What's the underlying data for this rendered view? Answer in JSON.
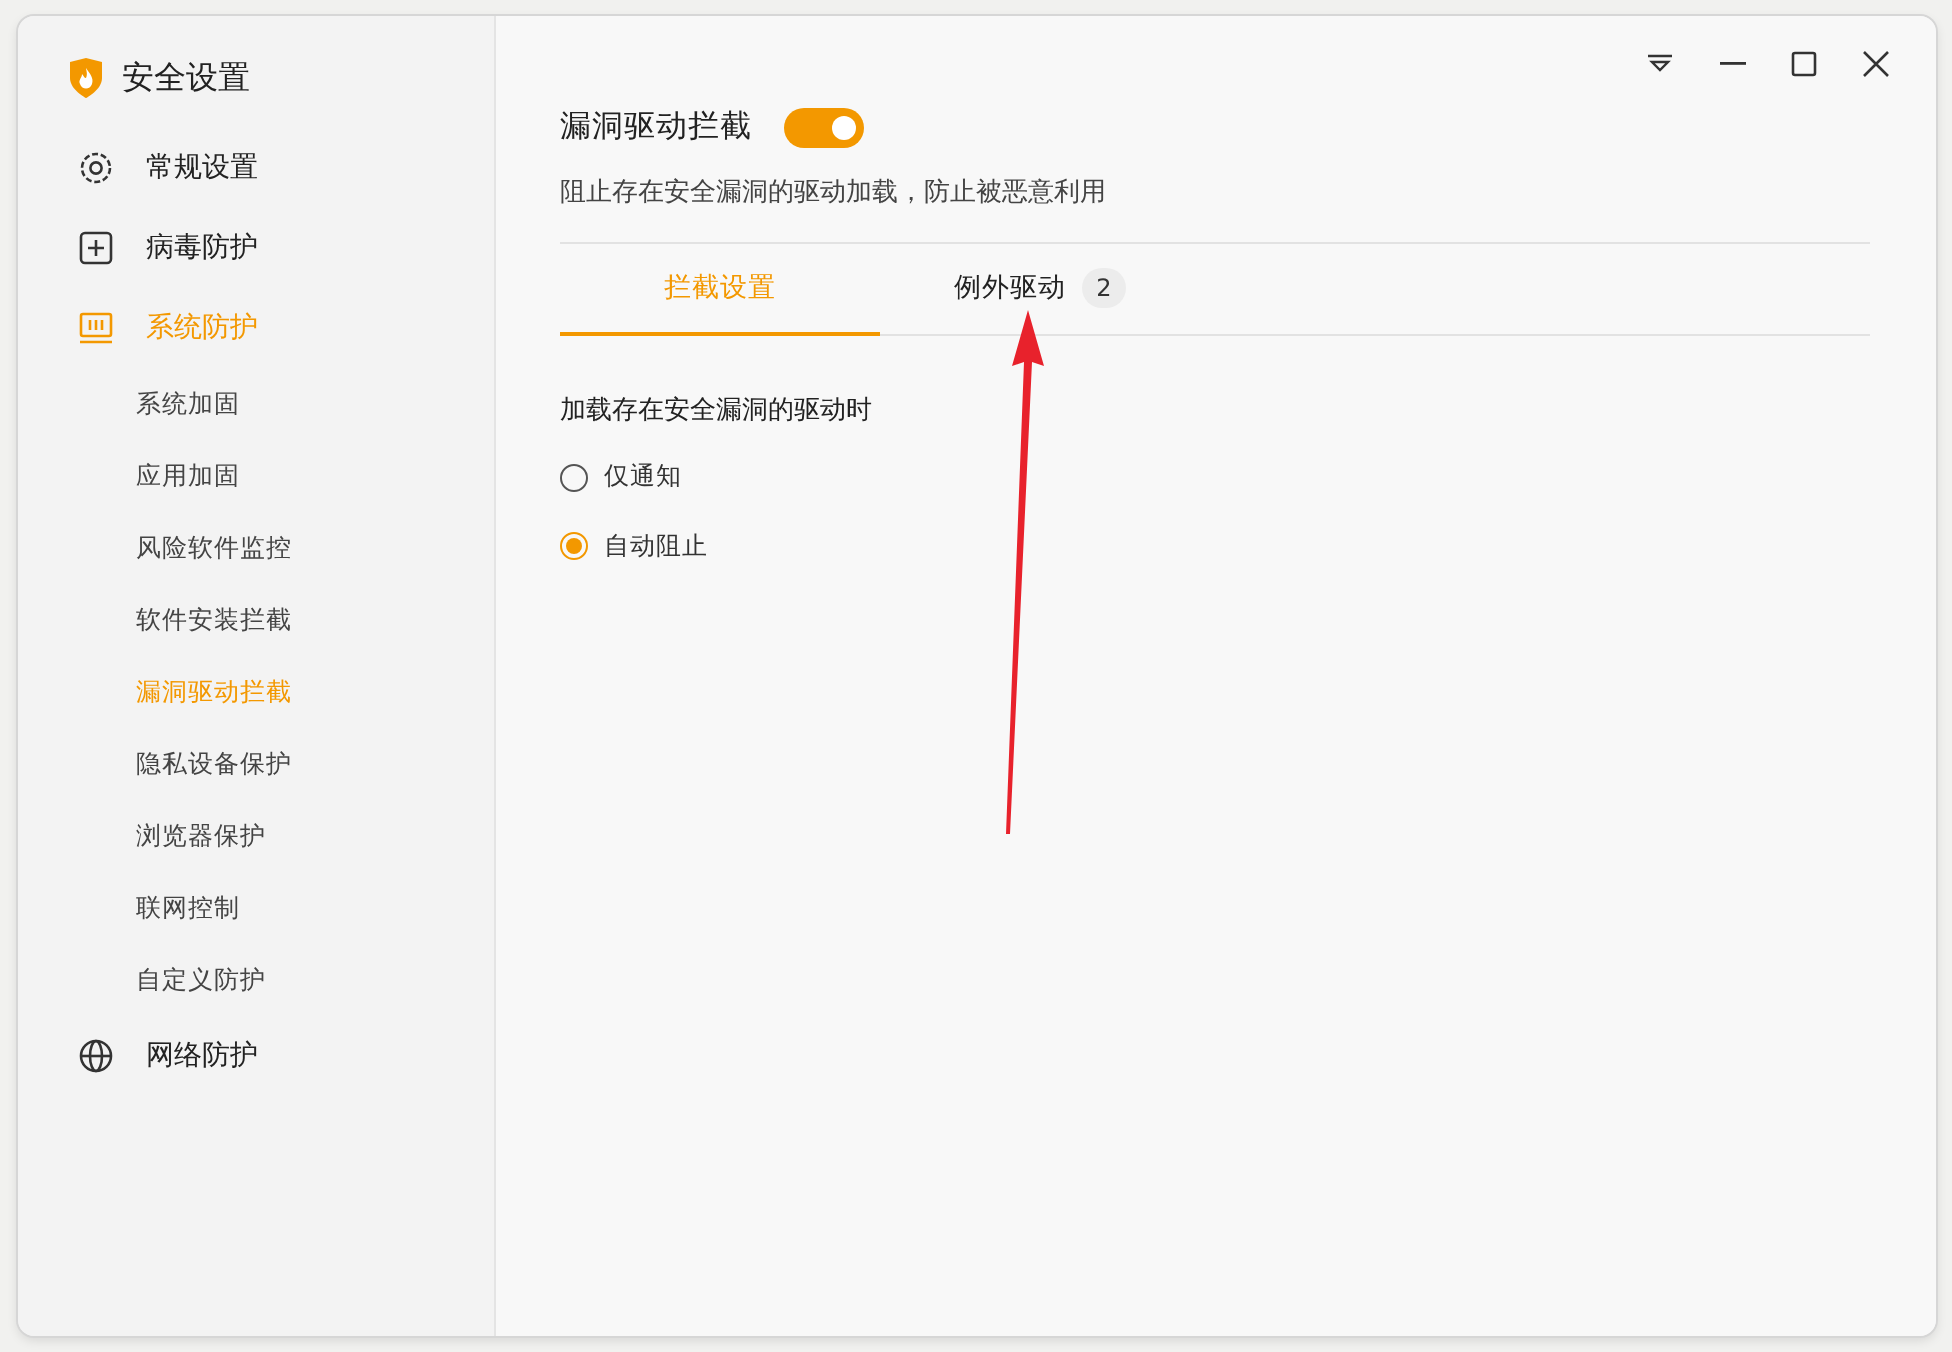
{
  "app": {
    "title": "安全设置"
  },
  "sidebar": {
    "items": [
      {
        "label": "常规设置",
        "selected": false
      },
      {
        "label": "病毒防护",
        "selected": false
      },
      {
        "label": "系统防护",
        "selected": true,
        "children": [
          {
            "label": "系统加固",
            "selected": false
          },
          {
            "label": "应用加固",
            "selected": false
          },
          {
            "label": "风险软件监控",
            "selected": false
          },
          {
            "label": "软件安装拦截",
            "selected": false
          },
          {
            "label": "漏洞驱动拦截",
            "selected": true
          },
          {
            "label": "隐私设备保护",
            "selected": false
          },
          {
            "label": "浏览器保护",
            "selected": false
          },
          {
            "label": "联网控制",
            "selected": false
          },
          {
            "label": "自定义防护",
            "selected": false
          }
        ]
      },
      {
        "label": "网络防护",
        "selected": false
      }
    ]
  },
  "feature": {
    "title": "漏洞驱动拦截",
    "on": true,
    "description": "阻止存在安全漏洞的驱动加载，防止被恶意利用"
  },
  "tabs": [
    {
      "label": "拦截设置",
      "selected": true
    },
    {
      "label": "例外驱动",
      "selected": false,
      "count": "2"
    }
  ],
  "setting": {
    "prompt": "加载存在安全漏洞的驱动时",
    "options": [
      {
        "label": "仅通知",
        "selected": false
      },
      {
        "label": "自动阻止",
        "selected": true
      }
    ]
  }
}
